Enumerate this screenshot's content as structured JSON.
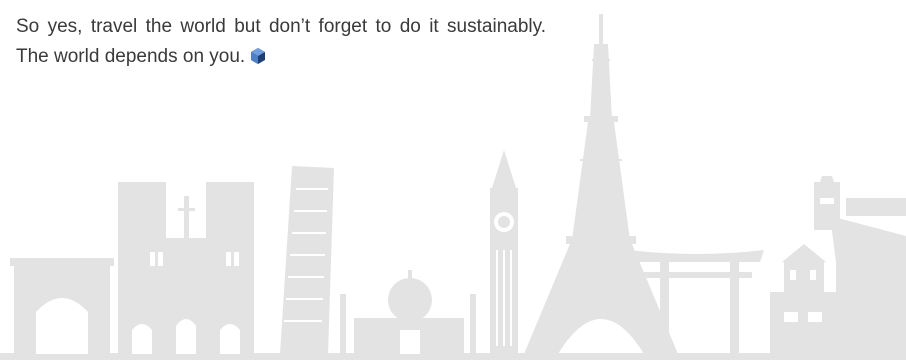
{
  "article": {
    "closing_paragraph": "So yes, travel the world but don’t forget to do it sustainably. The world depends on you."
  },
  "icons": {
    "end_mark": "blue-gem-icon",
    "illustration": "world-landmarks-skyline"
  },
  "colors": {
    "text": "#3a3a3a",
    "skyline": "#e3e3e3",
    "gem_light": "#4f7fc4",
    "gem_dark": "#1f3e73"
  }
}
